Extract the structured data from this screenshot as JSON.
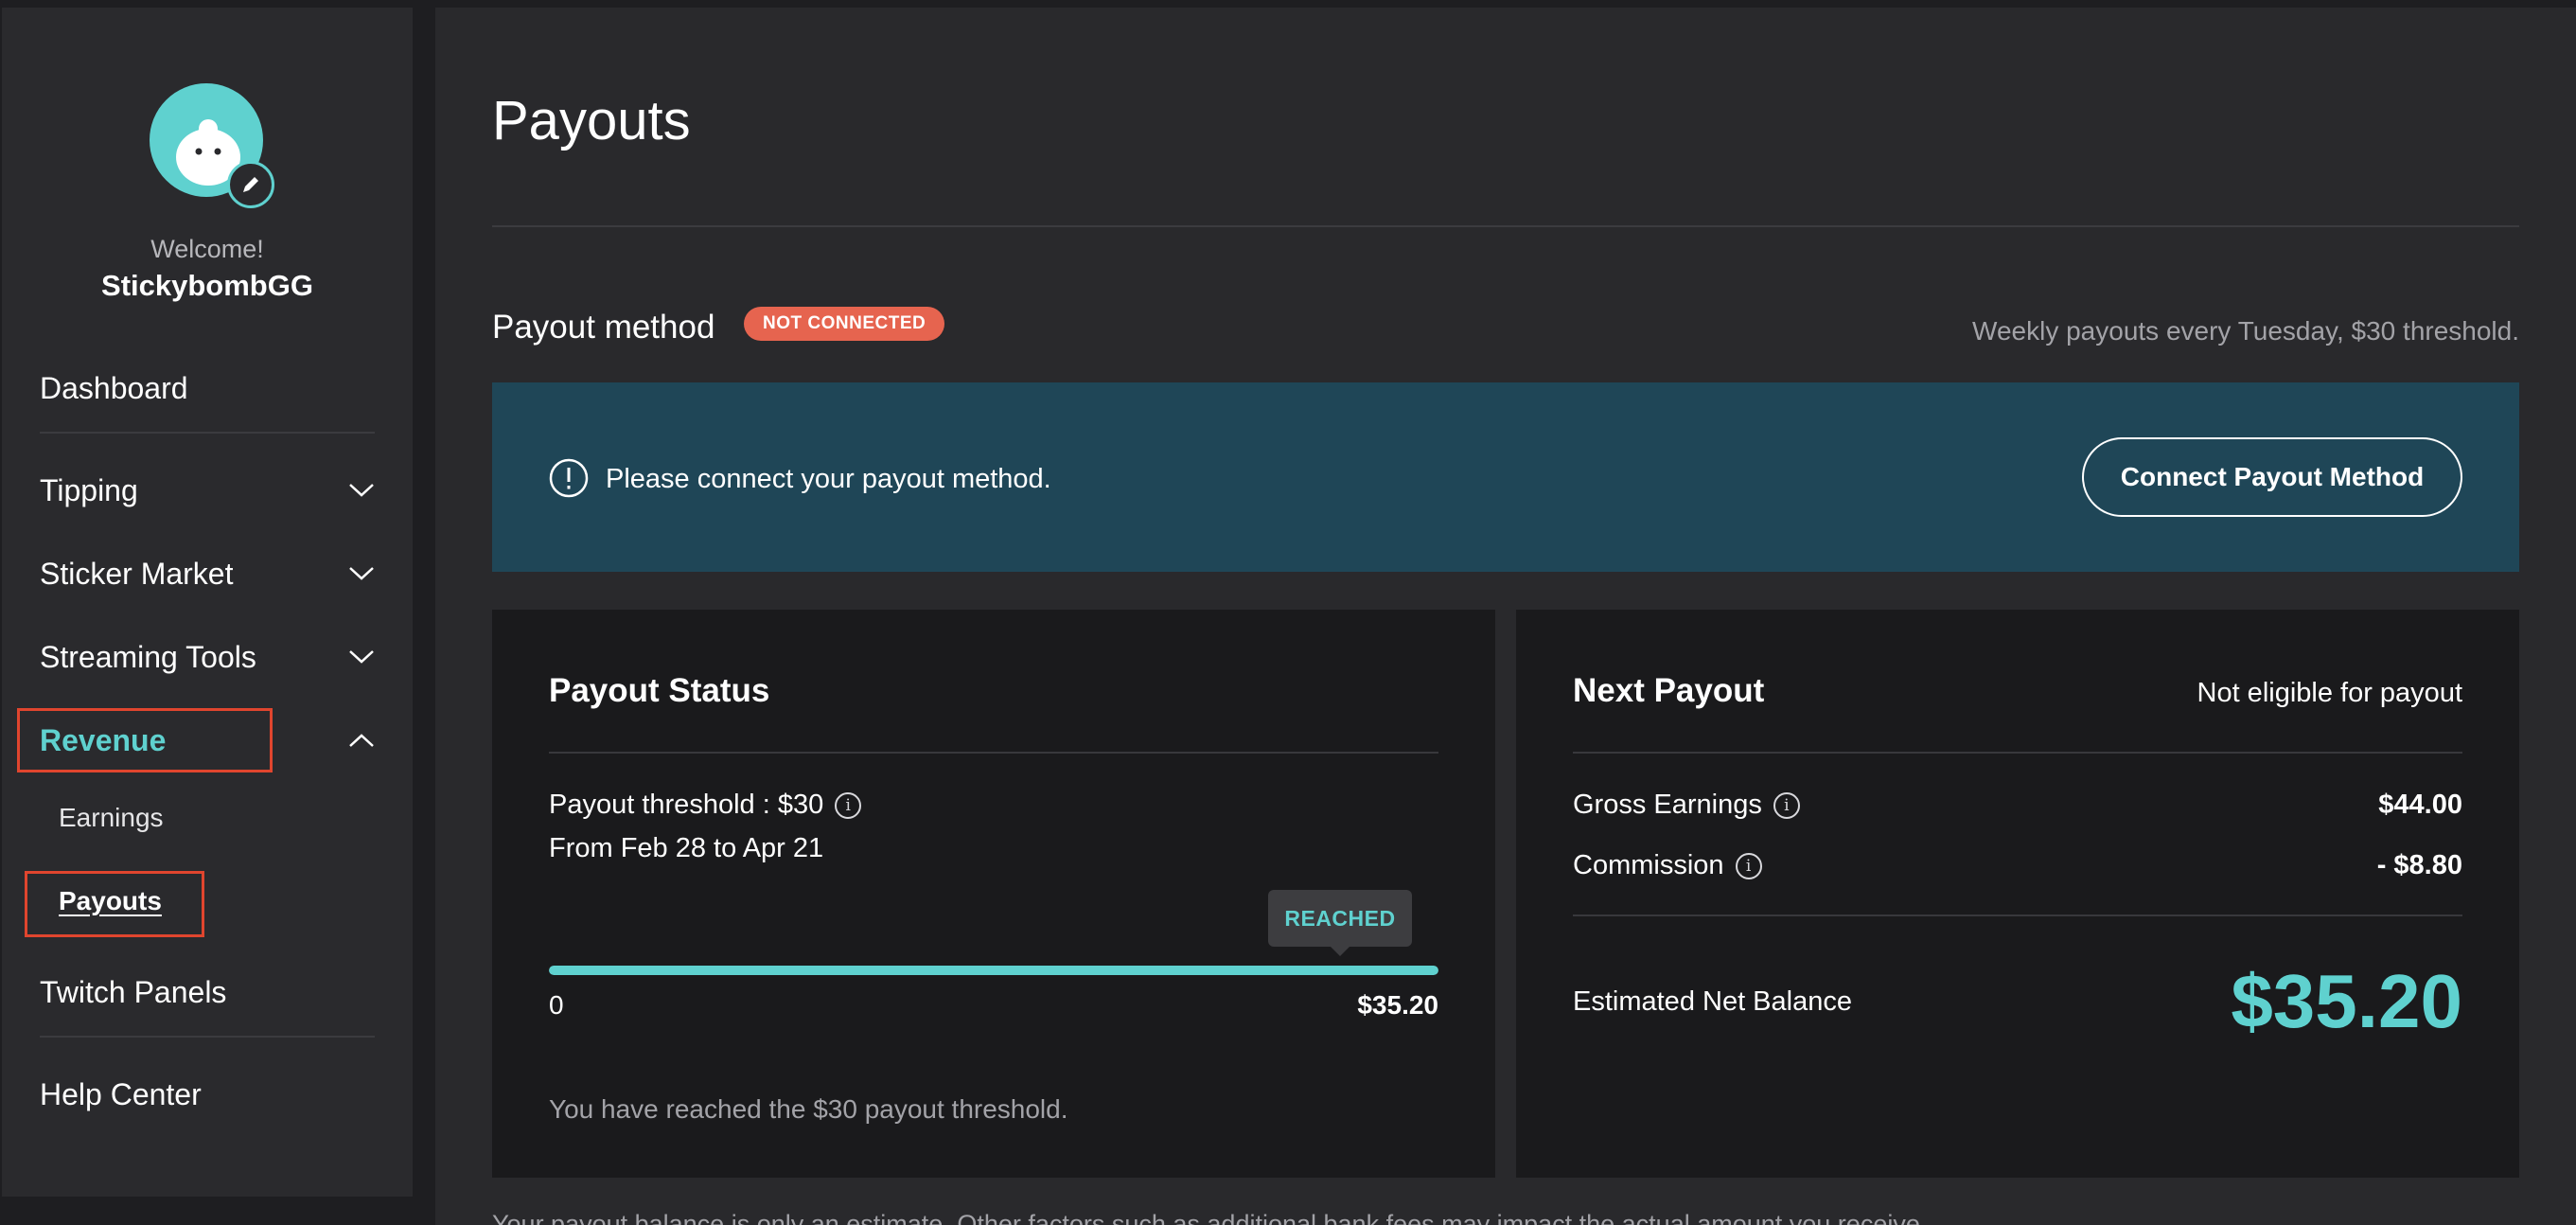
{
  "sidebar": {
    "welcome": "Welcome!",
    "username": "StickybombGG",
    "nav": {
      "dashboard": "Dashboard",
      "tipping": "Tipping",
      "sticker_market": "Sticker Market",
      "streaming_tools": "Streaming Tools",
      "revenue": "Revenue",
      "earnings": "Earnings",
      "payouts": "Payouts",
      "twitch_panels": "Twitch Panels",
      "help_center": "Help Center"
    }
  },
  "main": {
    "title": "Payouts",
    "payout_method": {
      "label": "Payout method",
      "badge": "NOT CONNECTED",
      "note": "Weekly payouts every Tuesday, $30 threshold."
    },
    "alert": {
      "message": "Please connect your payout method.",
      "button": "Connect Payout Method"
    },
    "payout_status": {
      "title": "Payout Status",
      "threshold": "Payout threshold : $30",
      "range": "From Feb 28 to Apr 21",
      "tooltip": "REACHED",
      "progress_min": "0",
      "progress_max": "$35.20",
      "progress_fraction": 1.0,
      "note": "You have reached the $30 payout threshold."
    },
    "next_payout": {
      "title": "Next Payout",
      "status": "Not eligible for payout",
      "gross_label": "Gross Earnings",
      "gross_value": "$44.00",
      "commission_label": "Commission",
      "commission_value": "- $8.80",
      "net_label": "Estimated Net Balance",
      "net_value": "$35.20"
    },
    "footer": "Your payout balance is only an estimate. Other factors such as additional bank fees may impact the actual amount you receive."
  },
  "colors": {
    "accent": "#5fd1cf",
    "badge": "#e6644f",
    "alert_bg": "#1f4657",
    "highlight": "#e0452e"
  }
}
